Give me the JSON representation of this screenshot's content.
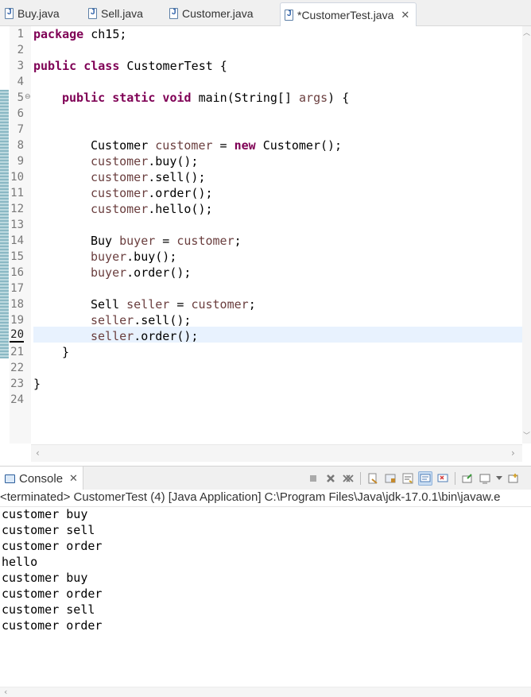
{
  "editor_tabs": [
    {
      "label": "Buy.java",
      "dirty": false
    },
    {
      "label": "Sell.java",
      "dirty": false
    },
    {
      "label": "Customer.java",
      "dirty": false
    },
    {
      "label": "*CustomerTest.java",
      "dirty": true,
      "active": true,
      "close": "✕"
    }
  ],
  "editor": {
    "line_numbers": [
      "1",
      "2",
      "3",
      "4",
      "5",
      "6",
      "7",
      "8",
      "9",
      "10",
      "11",
      "12",
      "13",
      "14",
      "15",
      "16",
      "17",
      "18",
      "19",
      "20",
      "21",
      "22",
      "23",
      "24"
    ],
    "current_line": "20",
    "fold_marker": "⊖",
    "code": {
      "l1_kw": "package",
      "l1_rest": " ch15;",
      "l3_kw": "public class",
      "l3_rest": " CustomerTest {",
      "l5_kw": "public static void",
      "l5_rest": " main(String[] ",
      "l5_param": "args",
      "l5_end": ") {",
      "l8_type": "Customer ",
      "l8_var": "customer",
      "l8_eq": " = ",
      "l8_kw": "new",
      "l8_rest": " Customer();",
      "l9_var": "customer",
      "l9_rest": ".buy();",
      "l10_var": "customer",
      "l10_rest": ".sell();",
      "l11_var": "customer",
      "l11_rest": ".order();",
      "l12_var": "customer",
      "l12_rest": ".hello();",
      "l14_type": "Buy ",
      "l14_var": "buyer",
      "l14_eq": " = ",
      "l14_rhs": "customer",
      "l14_end": ";",
      "l15_var": "buyer",
      "l15_rest": ".buy();",
      "l16_var": "buyer",
      "l16_rest": ".order();",
      "l18_type": "Sell ",
      "l18_var": "seller",
      "l18_eq": " = ",
      "l18_rhs": "customer",
      "l18_end": ";",
      "l19_var": "seller",
      "l19_rest": ".sell();",
      "l20_var": "seller",
      "l20_rest": ".order();",
      "l21": "}",
      "l23": "}"
    }
  },
  "console": {
    "tab_label": "Console",
    "close": "✕",
    "toolbar_icons": [
      "terminate-icon",
      "remove-launch-icon",
      "remove-all-terminated-icon",
      "clear-console-icon",
      "scroll-lock-icon",
      "word-wrap-icon",
      "show-on-stdout-icon",
      "show-on-stderr-icon",
      "pin-console-icon",
      "display-console-icon",
      "dropdown-icon",
      "open-console-icon"
    ],
    "status": "<terminated> CustomerTest (4) [Java Application] C:\\Program Files\\Java\\jdk-17.0.1\\bin\\javaw.e",
    "output_lines": [
      "customer buy",
      "customer sell",
      "customer order",
      "hello",
      "customer buy",
      "customer order",
      "customer sell",
      "customer order"
    ]
  },
  "colors": {
    "keyword": "#7f0055",
    "local_variable": "#6a3e3e",
    "current_line_bg": "#e8f2fe",
    "line_number": "#787878"
  }
}
